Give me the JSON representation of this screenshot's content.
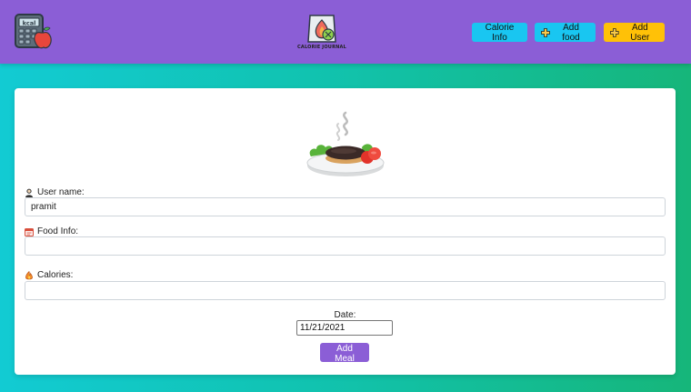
{
  "navbar": {
    "brand_text": "CALORIE JOURNAL",
    "buttons": {
      "calorie_info": "Calorie Info",
      "add_food": "Add food",
      "add_user": "Add User"
    }
  },
  "form": {
    "user_name": {
      "label": "User name:",
      "value": "pramit"
    },
    "food_info": {
      "label": "Food Info:",
      "value": ""
    },
    "calories": {
      "label": "Calories:",
      "value": ""
    },
    "date": {
      "label": "Date:",
      "value": "11/21/2021"
    },
    "submit_label": "Add Meal"
  },
  "colors": {
    "navbar": "#8b5ed6",
    "info_button": "#19c6f1",
    "warning_button": "#ffc107",
    "submit_button": "#8b5ed6"
  },
  "icons": [
    "calculator-apple-icon",
    "calorie-journal-logo",
    "plus-icon",
    "dish-illustration",
    "user-icon",
    "food-box-icon",
    "flame-icon"
  ]
}
